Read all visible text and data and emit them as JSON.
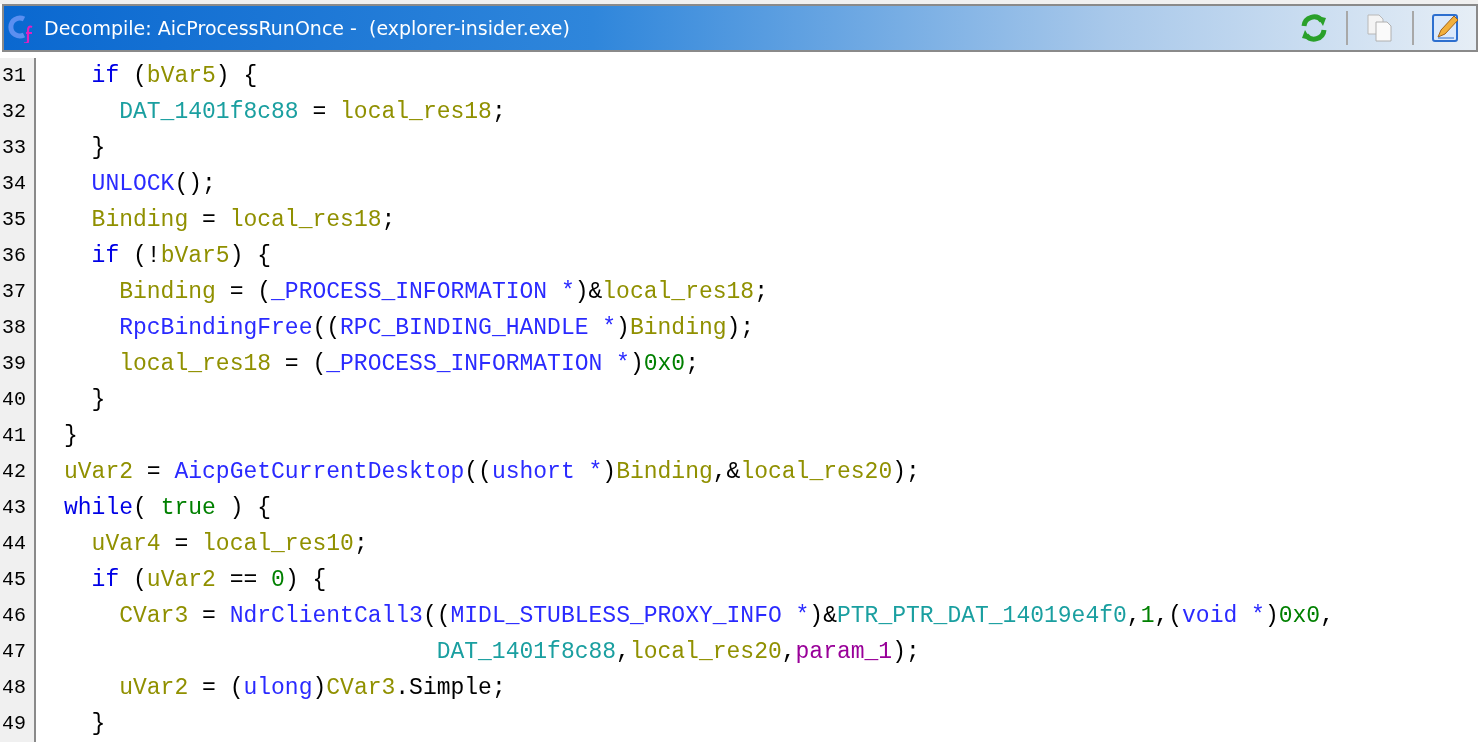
{
  "window": {
    "title": "Decompile: AicProcessRunOnce -  (explorer-insider.exe)"
  },
  "code_lines": [
    {
      "number": "31",
      "tokens": [
        {
          "text": "  if",
          "kind": "keyword"
        },
        {
          "text": " (",
          "kind": "plain"
        },
        {
          "text": "bVar5",
          "kind": "variable"
        },
        {
          "text": ") {",
          "kind": "plain"
        }
      ]
    },
    {
      "number": "32",
      "tokens": [
        {
          "text": "    DAT_1401f8c88",
          "kind": "global"
        },
        {
          "text": " = ",
          "kind": "plain"
        },
        {
          "text": "local_res18",
          "kind": "variable"
        },
        {
          "text": ";",
          "kind": "plain"
        }
      ]
    },
    {
      "number": "33",
      "tokens": [
        {
          "text": "  }",
          "kind": "plain"
        }
      ]
    },
    {
      "number": "34",
      "tokens": [
        {
          "text": "  UNLOCK",
          "kind": "function"
        },
        {
          "text": "();",
          "kind": "plain"
        }
      ]
    },
    {
      "number": "35",
      "tokens": [
        {
          "text": "  Binding",
          "kind": "variable"
        },
        {
          "text": " = ",
          "kind": "plain"
        },
        {
          "text": "local_res18",
          "kind": "variable"
        },
        {
          "text": ";",
          "kind": "plain"
        }
      ]
    },
    {
      "number": "36",
      "tokens": [
        {
          "text": "  if",
          "kind": "keyword"
        },
        {
          "text": " (!",
          "kind": "plain"
        },
        {
          "text": "bVar5",
          "kind": "variable"
        },
        {
          "text": ") {",
          "kind": "plain"
        }
      ]
    },
    {
      "number": "37",
      "tokens": [
        {
          "text": "    Binding",
          "kind": "variable"
        },
        {
          "text": " = (",
          "kind": "plain"
        },
        {
          "text": "_PROCESS_INFORMATION *",
          "kind": "type"
        },
        {
          "text": ")&",
          "kind": "plain"
        },
        {
          "text": "local_res18",
          "kind": "variable"
        },
        {
          "text": ";",
          "kind": "plain"
        }
      ]
    },
    {
      "number": "38",
      "tokens": [
        {
          "text": "    RpcBindingFree",
          "kind": "function"
        },
        {
          "text": "((",
          "kind": "plain"
        },
        {
          "text": "RPC_BINDING_HANDLE *",
          "kind": "type"
        },
        {
          "text": ")",
          "kind": "plain"
        },
        {
          "text": "Binding",
          "kind": "variable"
        },
        {
          "text": ");",
          "kind": "plain"
        }
      ]
    },
    {
      "number": "39",
      "tokens": [
        {
          "text": "    local_res18",
          "kind": "variable"
        },
        {
          "text": " = (",
          "kind": "plain"
        },
        {
          "text": "_PROCESS_INFORMATION *",
          "kind": "type"
        },
        {
          "text": ")",
          "kind": "plain"
        },
        {
          "text": "0x0",
          "kind": "constant"
        },
        {
          "text": ";",
          "kind": "plain"
        }
      ]
    },
    {
      "number": "40",
      "tokens": [
        {
          "text": "  }",
          "kind": "plain"
        }
      ]
    },
    {
      "number": "41",
      "tokens": [
        {
          "text": "}",
          "kind": "plain"
        }
      ]
    },
    {
      "number": "42",
      "tokens": [
        {
          "text": "uVar2",
          "kind": "variable"
        },
        {
          "text": " = ",
          "kind": "plain"
        },
        {
          "text": "AicpGetCurrentDesktop",
          "kind": "function"
        },
        {
          "text": "((",
          "kind": "plain"
        },
        {
          "text": "ushort *",
          "kind": "type"
        },
        {
          "text": ")",
          "kind": "plain"
        },
        {
          "text": "Binding",
          "kind": "variable"
        },
        {
          "text": ",&",
          "kind": "plain"
        },
        {
          "text": "local_res20",
          "kind": "variable"
        },
        {
          "text": ");",
          "kind": "plain"
        }
      ]
    },
    {
      "number": "43",
      "tokens": [
        {
          "text": "while",
          "kind": "keyword"
        },
        {
          "text": "( ",
          "kind": "plain"
        },
        {
          "text": "true",
          "kind": "constant"
        },
        {
          "text": " ) {",
          "kind": "plain"
        }
      ]
    },
    {
      "number": "44",
      "tokens": [
        {
          "text": "  uVar4",
          "kind": "variable"
        },
        {
          "text": " = ",
          "kind": "plain"
        },
        {
          "text": "local_res10",
          "kind": "variable"
        },
        {
          "text": ";",
          "kind": "plain"
        }
      ]
    },
    {
      "number": "45",
      "tokens": [
        {
          "text": "  if",
          "kind": "keyword"
        },
        {
          "text": " (",
          "kind": "plain"
        },
        {
          "text": "uVar2",
          "kind": "variable"
        },
        {
          "text": " == ",
          "kind": "plain"
        },
        {
          "text": "0",
          "kind": "constant"
        },
        {
          "text": ") {",
          "kind": "plain"
        }
      ]
    },
    {
      "number": "46",
      "tokens": [
        {
          "text": "    CVar3",
          "kind": "variable"
        },
        {
          "text": " = ",
          "kind": "plain"
        },
        {
          "text": "NdrClientCall3",
          "kind": "function"
        },
        {
          "text": "((",
          "kind": "plain"
        },
        {
          "text": "MIDL_STUBLESS_PROXY_INFO *",
          "kind": "type"
        },
        {
          "text": ")&",
          "kind": "plain"
        },
        {
          "text": "PTR_PTR_DAT_14019e4f0",
          "kind": "global"
        },
        {
          "text": ",",
          "kind": "plain"
        },
        {
          "text": "1",
          "kind": "constant"
        },
        {
          "text": ",(",
          "kind": "plain"
        },
        {
          "text": "void *",
          "kind": "type"
        },
        {
          "text": ")",
          "kind": "plain"
        },
        {
          "text": "0x0",
          "kind": "constant"
        },
        {
          "text": ",",
          "kind": "plain"
        }
      ]
    },
    {
      "number": "47",
      "tokens": [
        {
          "text": "                           DAT_1401f8c88",
          "kind": "global"
        },
        {
          "text": ",",
          "kind": "plain"
        },
        {
          "text": "local_res20",
          "kind": "variable"
        },
        {
          "text": ",",
          "kind": "plain"
        },
        {
          "text": "param_1",
          "kind": "parameter"
        },
        {
          "text": ");",
          "kind": "plain"
        }
      ]
    },
    {
      "number": "48",
      "tokens": [
        {
          "text": "    uVar2",
          "kind": "variable"
        },
        {
          "text": " = (",
          "kind": "plain"
        },
        {
          "text": "ulong",
          "kind": "type"
        },
        {
          "text": ")",
          "kind": "plain"
        },
        {
          "text": "CVar3",
          "kind": "variable"
        },
        {
          "text": ".Simple;",
          "kind": "plain"
        }
      ]
    },
    {
      "number": "49",
      "tokens": [
        {
          "text": "  }",
          "kind": "plain"
        }
      ]
    }
  ]
}
